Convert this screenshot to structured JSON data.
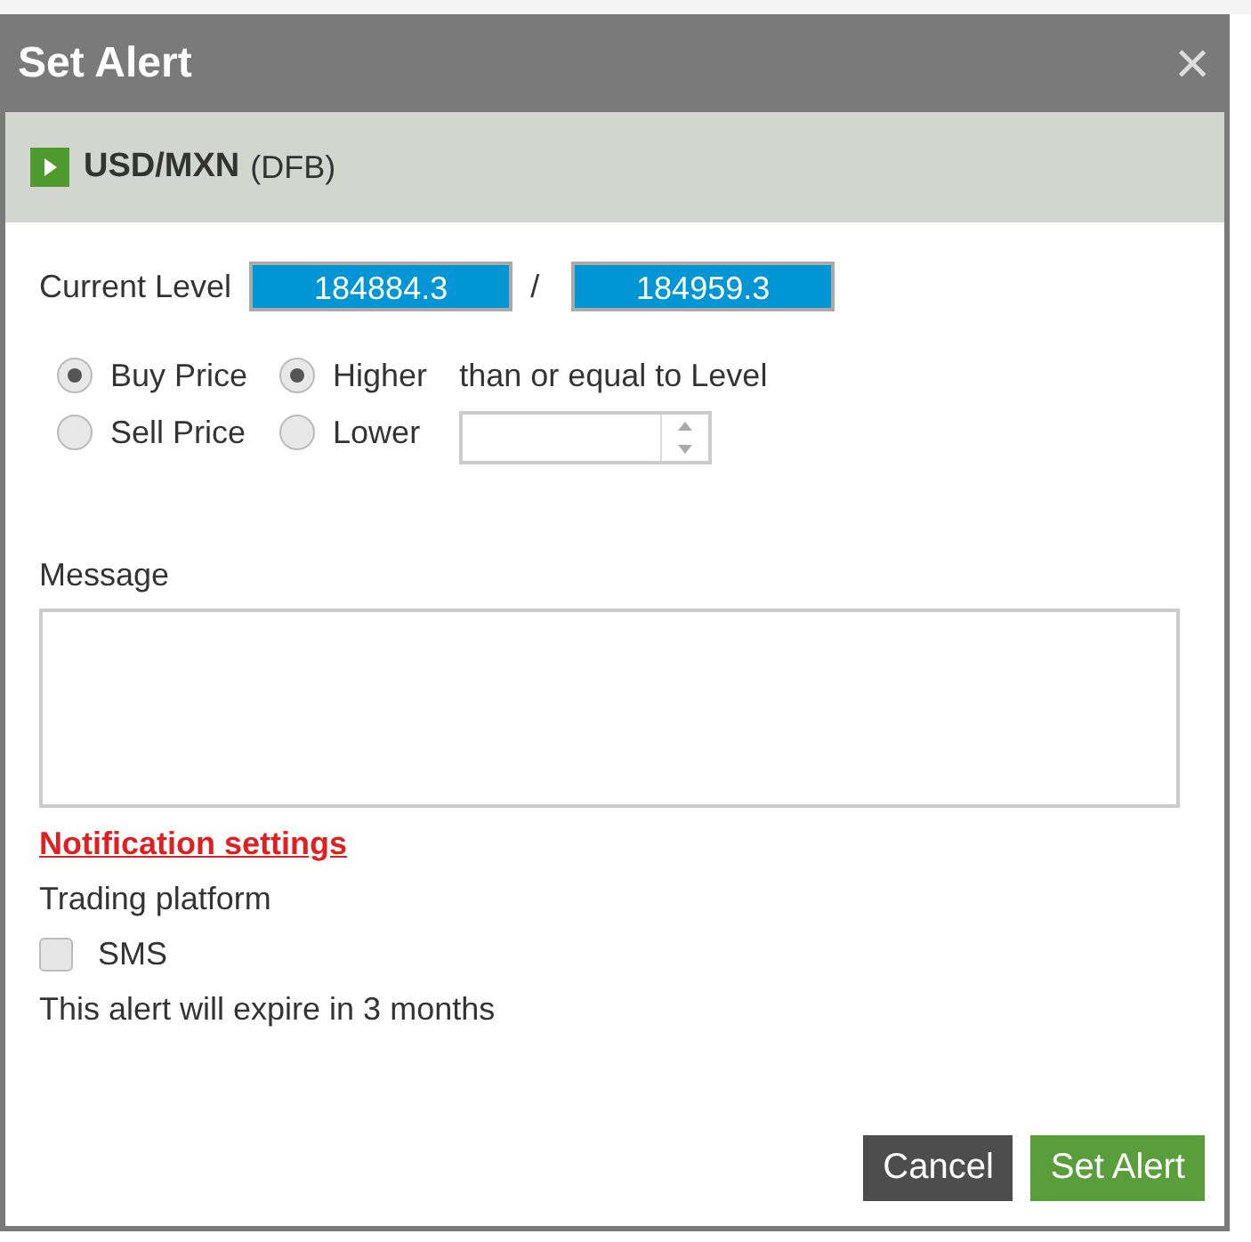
{
  "dialog": {
    "title": "Set Alert",
    "close": "×"
  },
  "instrument": {
    "name": "USD/MXN",
    "type": "(DFB)"
  },
  "current_level": {
    "label": "Current Level",
    "sell": "184884.3",
    "separator": "/",
    "buy": "184959.3"
  },
  "price_options": [
    {
      "label": "Buy Price",
      "selected": true
    },
    {
      "label": "Sell Price",
      "selected": false
    }
  ],
  "direction_options": [
    {
      "label": "Higher",
      "selected": true
    },
    {
      "label": "Lower",
      "selected": false
    }
  ],
  "condition_text": "than or equal to Level",
  "message": {
    "label": "Message"
  },
  "notification": {
    "link": "Notification settings",
    "platform": "Trading platform",
    "sms": {
      "label": "SMS",
      "checked": false
    },
    "expiry": "This alert will expire in 3 months"
  },
  "buttons": [
    {
      "label": "Cancel",
      "kind": "secondary"
    },
    {
      "label": "Set Alert",
      "kind": "primary"
    }
  ]
}
